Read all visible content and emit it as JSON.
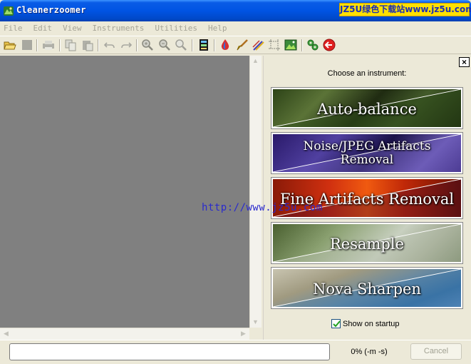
{
  "window": {
    "title": "Cleanerzoomer",
    "watermark": "JZ5U绿色下载站www.jz5u.com"
  },
  "menu": {
    "items": [
      {
        "label": "File"
      },
      {
        "label": "Edit"
      },
      {
        "label": "View"
      },
      {
        "label": "Instruments"
      },
      {
        "label": "Utilities"
      },
      {
        "label": "Help"
      }
    ]
  },
  "toolbar": {
    "icons": [
      "open-folder-icon",
      "save-icon",
      "print-icon",
      "copy-icon",
      "paste-icon",
      "undo-icon",
      "redo-icon",
      "zoom-in-icon",
      "zoom-out-icon",
      "zoom-fit-icon",
      "film-strip-icon",
      "color-drop-icon",
      "brush-icon",
      "magic-wand-icon",
      "crop-icon",
      "image-icon",
      "settings-icon",
      "back-arrow-icon"
    ]
  },
  "overlay": {
    "url": "http://www.jz5u.com"
  },
  "panel": {
    "close_label": "×",
    "choose_label": "Choose an instrument:",
    "instruments": [
      {
        "label": "Auto-balance"
      },
      {
        "label_line1": "Noise/JPEG Artifacts",
        "label_line2": "Removal"
      },
      {
        "label": "Fine Artifacts Removal"
      },
      {
        "label": "Resample"
      },
      {
        "label": "Nova Sharpen"
      }
    ],
    "show_on_startup": {
      "label": "Show on startup",
      "checked": true
    }
  },
  "status": {
    "progress_percent": 0,
    "progress_text": "0% (-m -s)",
    "cancel_label": "Cancel"
  }
}
